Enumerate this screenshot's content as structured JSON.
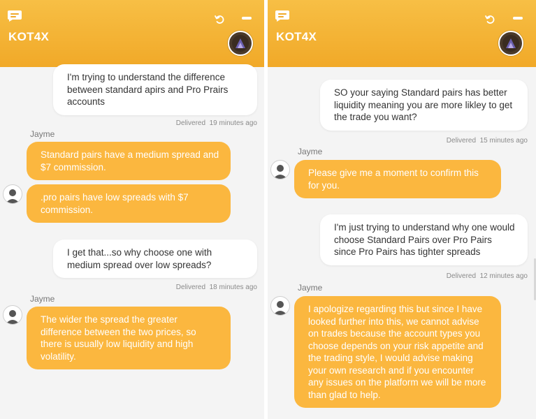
{
  "left": {
    "brand": "KOT4X",
    "messages": {
      "m1": "I'm trying to understand the difference between standard apirs and Pro Prairs accounts",
      "m1_status": "Delivered",
      "m1_time": "19 minutes ago",
      "sender1": "Jayme",
      "a1": "Standard pairs have a medium spread and $7 commission.",
      "a2": ".pro pairs have low spreads with $7 commission.",
      "m2": "I get that...so why choose one with medium spread over low spreads?",
      "m2_status": "Delivered",
      "m2_time": "18 minutes ago",
      "sender2": "Jayme",
      "a3": "The wider the spread the greater difference between the two prices, so there is usually low liquidity and high volatility."
    }
  },
  "right": {
    "brand": "KOT4X",
    "messages": {
      "m1": "SO your saying Standard pairs has better liquidity meaning you are more likley to get the trade you want?",
      "m1_status": "Delivered",
      "m1_time": "15 minutes ago",
      "sender1": "Jayme",
      "a1": "Please give me a moment to confirm this for you.",
      "m2": "I'm just trying to understand why one would choose Standard Pairs over Pro Pairs since Pro Pairs has tighter spreads",
      "m2_status": "Delivered",
      "m2_time": "12 minutes ago",
      "sender2": "Jayme",
      "a2": "I apologize regarding this but since I have looked further into this, we cannot advise on trades because the account types you choose depends on your risk appetite and the trading style, I would advise making your own research and if you encounter any issues on the platform we will be more than glad to help."
    }
  },
  "colors": {
    "header": "#f1a928",
    "agent_bubble": "#fbb73f",
    "user_bubble": "#ffffff",
    "background": "#f4f4f4"
  },
  "icons": [
    "chat-bubble-icon",
    "undo-icon",
    "minimize-icon",
    "brand-logo-avatar",
    "agent-avatar-icon"
  ]
}
